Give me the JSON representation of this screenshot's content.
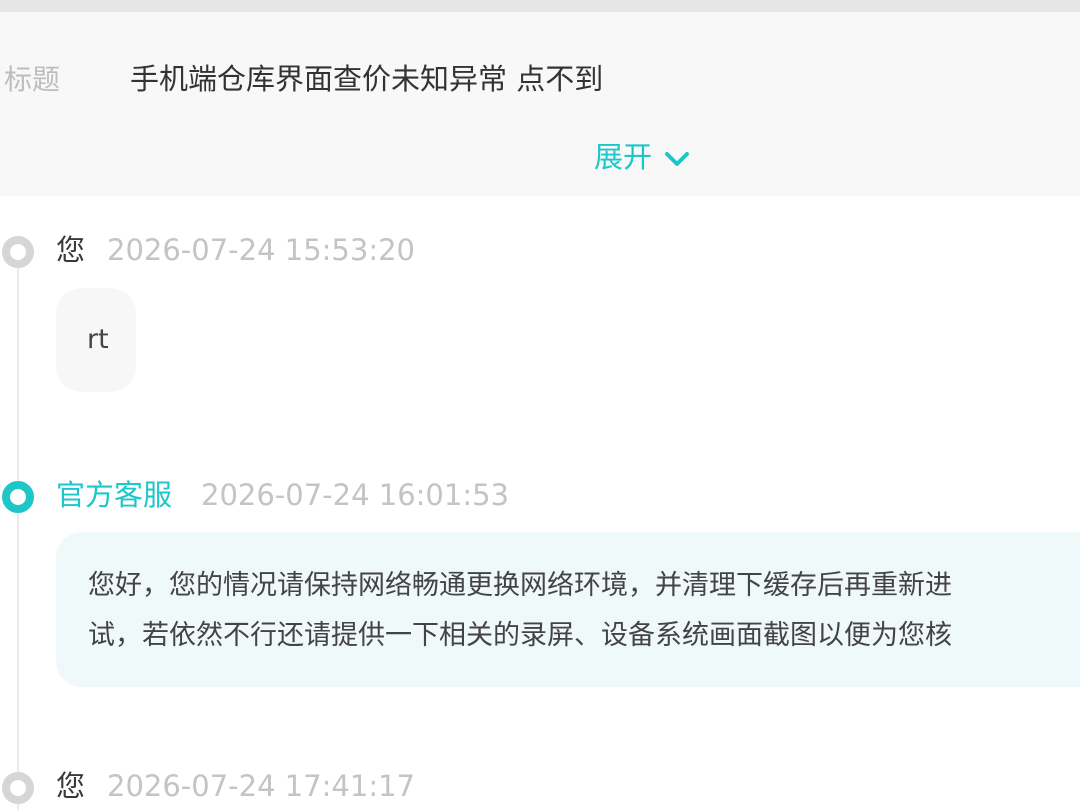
{
  "header": {
    "title_label": "标题",
    "title_value": "手机端仓库界面查价未知异常 点不到",
    "expand_label": "展开"
  },
  "timeline": [
    {
      "author": "您",
      "timestamp": "2026-07-24 15:53:20",
      "message": "rt"
    },
    {
      "author": "官方客服",
      "timestamp": "2026-07-24 16:01:53",
      "message_lines": [
        "您好，您的情况请保持网络畅通更换网络环境，并清理下缓存后再重新进",
        "试，若依然不行还请提供一下相关的录屏、设备系统画面截图以便为您核"
      ]
    },
    {
      "author": "您",
      "timestamp": "2026-07-24 17:41:17"
    }
  ],
  "icons": {
    "expand": "chevron-down-icon",
    "user_marker": "timeline-dot-icon",
    "official_marker": "timeline-dot-active-icon"
  },
  "colors": {
    "accent": "#1ec7c7",
    "header_bg": "#f8f8f8",
    "official_bubble_bg": "#eff9f9",
    "user_bubble_bg": "#f7f7f7",
    "muted_text": "#c4c4c4",
    "body_text": "#333333",
    "inactive_dot": "#d6d6d6"
  }
}
